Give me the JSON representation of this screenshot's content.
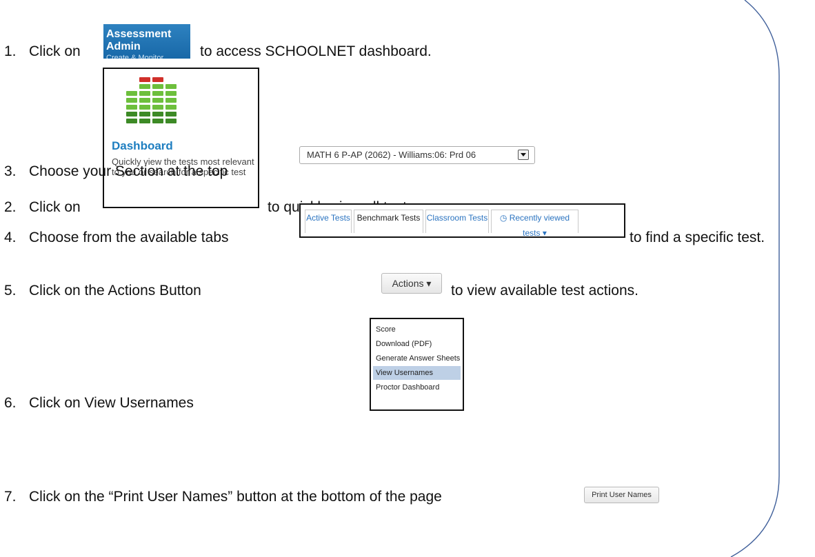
{
  "steps": [
    {
      "number": "1.",
      "pre": "Click on",
      "post": "to access SCHOOLNET dashboard."
    },
    {
      "number": "2.",
      "pre": "Click on",
      "post": "to quickly view all tests."
    },
    {
      "number": "3.",
      "text": "Choose your Section at the top"
    },
    {
      "number": "4.",
      "pre": "Choose from the available tabs",
      "post": "to find a specific test."
    },
    {
      "number": "5.",
      "pre": "Click on the Actions Button",
      "post": "to view available test actions."
    },
    {
      "number": "6.",
      "text": "Click on View Usernames"
    },
    {
      "number": "7.",
      "text": "Click on the “Print User Names” button at the bottom of the page"
    }
  ],
  "assessment_tile": {
    "title": "Assessment Admin",
    "subtitle": "Create & Monitor",
    "color": "#1f6fb0"
  },
  "dashboard_tile": {
    "icon": "equalizer-bars-icon",
    "title": "Dashboard",
    "description": "Quickly view the tests most relevant to you or search for a specific test"
  },
  "section_select": {
    "value": "MATH 6 P-AP (2062) - Williams:06: Prd 06"
  },
  "tabs": [
    {
      "label": "Active Tests"
    },
    {
      "label": "Benchmark Tests"
    },
    {
      "label": "Classroom Tests"
    },
    {
      "label": "Recently viewed tests ▾",
      "icon": "clock-icon"
    }
  ],
  "actions_button": {
    "label": "Actions ▾"
  },
  "actions_menu": {
    "items": [
      {
        "label": "Score"
      },
      {
        "label": "Download (PDF)"
      },
      {
        "label": "Generate Answer Sheets"
      },
      {
        "label": "View Usernames"
      },
      {
        "label": "Proctor Dashboard"
      }
    ],
    "highlighted": "View Usernames"
  },
  "print_button": {
    "label": "Print User Names"
  }
}
